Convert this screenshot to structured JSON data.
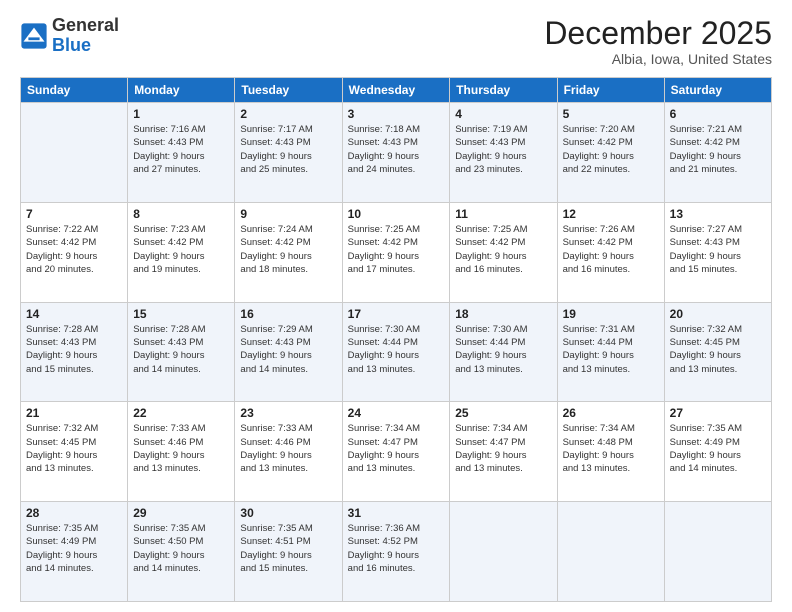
{
  "logo": {
    "general": "General",
    "blue": "Blue"
  },
  "title": "December 2025",
  "location": "Albia, Iowa, United States",
  "days_of_week": [
    "Sunday",
    "Monday",
    "Tuesday",
    "Wednesday",
    "Thursday",
    "Friday",
    "Saturday"
  ],
  "weeks": [
    [
      {
        "day": "",
        "info": ""
      },
      {
        "day": "1",
        "info": "Sunrise: 7:16 AM\nSunset: 4:43 PM\nDaylight: 9 hours\nand 27 minutes."
      },
      {
        "day": "2",
        "info": "Sunrise: 7:17 AM\nSunset: 4:43 PM\nDaylight: 9 hours\nand 25 minutes."
      },
      {
        "day": "3",
        "info": "Sunrise: 7:18 AM\nSunset: 4:43 PM\nDaylight: 9 hours\nand 24 minutes."
      },
      {
        "day": "4",
        "info": "Sunrise: 7:19 AM\nSunset: 4:43 PM\nDaylight: 9 hours\nand 23 minutes."
      },
      {
        "day": "5",
        "info": "Sunrise: 7:20 AM\nSunset: 4:42 PM\nDaylight: 9 hours\nand 22 minutes."
      },
      {
        "day": "6",
        "info": "Sunrise: 7:21 AM\nSunset: 4:42 PM\nDaylight: 9 hours\nand 21 minutes."
      }
    ],
    [
      {
        "day": "7",
        "info": "Sunrise: 7:22 AM\nSunset: 4:42 PM\nDaylight: 9 hours\nand 20 minutes."
      },
      {
        "day": "8",
        "info": "Sunrise: 7:23 AM\nSunset: 4:42 PM\nDaylight: 9 hours\nand 19 minutes."
      },
      {
        "day": "9",
        "info": "Sunrise: 7:24 AM\nSunset: 4:42 PM\nDaylight: 9 hours\nand 18 minutes."
      },
      {
        "day": "10",
        "info": "Sunrise: 7:25 AM\nSunset: 4:42 PM\nDaylight: 9 hours\nand 17 minutes."
      },
      {
        "day": "11",
        "info": "Sunrise: 7:25 AM\nSunset: 4:42 PM\nDaylight: 9 hours\nand 16 minutes."
      },
      {
        "day": "12",
        "info": "Sunrise: 7:26 AM\nSunset: 4:42 PM\nDaylight: 9 hours\nand 16 minutes."
      },
      {
        "day": "13",
        "info": "Sunrise: 7:27 AM\nSunset: 4:43 PM\nDaylight: 9 hours\nand 15 minutes."
      }
    ],
    [
      {
        "day": "14",
        "info": "Sunrise: 7:28 AM\nSunset: 4:43 PM\nDaylight: 9 hours\nand 15 minutes."
      },
      {
        "day": "15",
        "info": "Sunrise: 7:28 AM\nSunset: 4:43 PM\nDaylight: 9 hours\nand 14 minutes."
      },
      {
        "day": "16",
        "info": "Sunrise: 7:29 AM\nSunset: 4:43 PM\nDaylight: 9 hours\nand 14 minutes."
      },
      {
        "day": "17",
        "info": "Sunrise: 7:30 AM\nSunset: 4:44 PM\nDaylight: 9 hours\nand 13 minutes."
      },
      {
        "day": "18",
        "info": "Sunrise: 7:30 AM\nSunset: 4:44 PM\nDaylight: 9 hours\nand 13 minutes."
      },
      {
        "day": "19",
        "info": "Sunrise: 7:31 AM\nSunset: 4:44 PM\nDaylight: 9 hours\nand 13 minutes."
      },
      {
        "day": "20",
        "info": "Sunrise: 7:32 AM\nSunset: 4:45 PM\nDaylight: 9 hours\nand 13 minutes."
      }
    ],
    [
      {
        "day": "21",
        "info": "Sunrise: 7:32 AM\nSunset: 4:45 PM\nDaylight: 9 hours\nand 13 minutes."
      },
      {
        "day": "22",
        "info": "Sunrise: 7:33 AM\nSunset: 4:46 PM\nDaylight: 9 hours\nand 13 minutes."
      },
      {
        "day": "23",
        "info": "Sunrise: 7:33 AM\nSunset: 4:46 PM\nDaylight: 9 hours\nand 13 minutes."
      },
      {
        "day": "24",
        "info": "Sunrise: 7:34 AM\nSunset: 4:47 PM\nDaylight: 9 hours\nand 13 minutes."
      },
      {
        "day": "25",
        "info": "Sunrise: 7:34 AM\nSunset: 4:47 PM\nDaylight: 9 hours\nand 13 minutes."
      },
      {
        "day": "26",
        "info": "Sunrise: 7:34 AM\nSunset: 4:48 PM\nDaylight: 9 hours\nand 13 minutes."
      },
      {
        "day": "27",
        "info": "Sunrise: 7:35 AM\nSunset: 4:49 PM\nDaylight: 9 hours\nand 14 minutes."
      }
    ],
    [
      {
        "day": "28",
        "info": "Sunrise: 7:35 AM\nSunset: 4:49 PM\nDaylight: 9 hours\nand 14 minutes."
      },
      {
        "day": "29",
        "info": "Sunrise: 7:35 AM\nSunset: 4:50 PM\nDaylight: 9 hours\nand 14 minutes."
      },
      {
        "day": "30",
        "info": "Sunrise: 7:35 AM\nSunset: 4:51 PM\nDaylight: 9 hours\nand 15 minutes."
      },
      {
        "day": "31",
        "info": "Sunrise: 7:36 AM\nSunset: 4:52 PM\nDaylight: 9 hours\nand 16 minutes."
      },
      {
        "day": "",
        "info": ""
      },
      {
        "day": "",
        "info": ""
      },
      {
        "day": "",
        "info": ""
      }
    ]
  ]
}
